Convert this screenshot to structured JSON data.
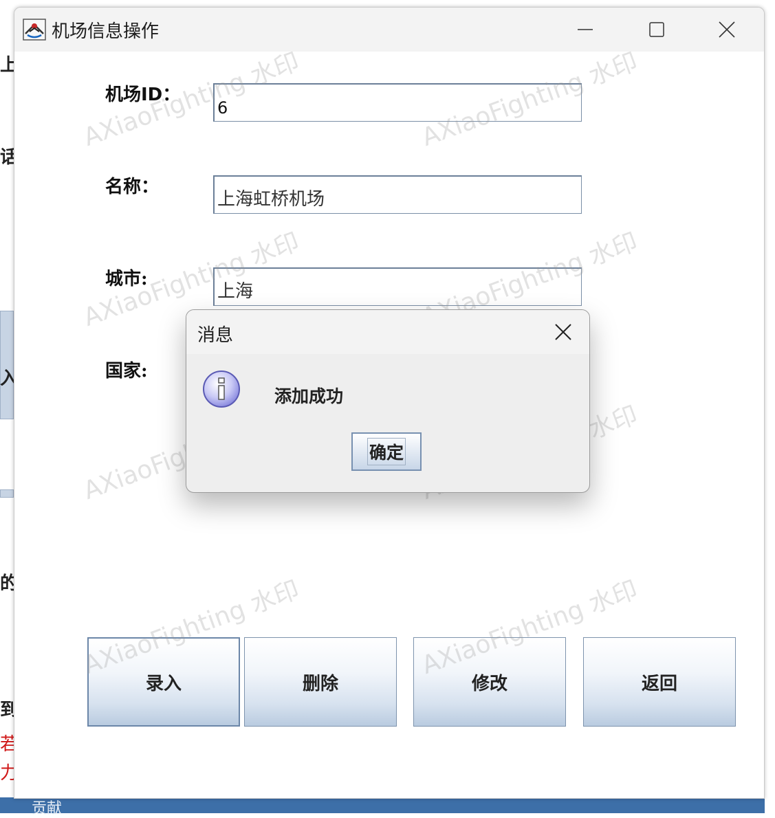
{
  "window": {
    "title": "机场信息操作",
    "controls": {
      "minimize": "minimize",
      "maximize": "maximize",
      "close": "close"
    }
  },
  "form": {
    "airport_id_label": "机场ID：",
    "airport_id_value": "6",
    "name_label": "名称：",
    "name_value": "上海虹桥机场",
    "city_label": "城市:",
    "city_value": "上海",
    "country_label": "国家:"
  },
  "actions": {
    "enter": "录入",
    "delete": "删除",
    "modify": "修改",
    "back": "返回"
  },
  "dialog": {
    "title": "消息",
    "message": "添加成功",
    "ok": "确定",
    "icon": "info-icon"
  },
  "watermark": "AXiaoFighting 水印",
  "background": {
    "fragments": [
      "上",
      "话",
      "入",
      "的",
      "到",
      "若",
      "力"
    ],
    "taskbar_text": "贡献"
  },
  "colors": {
    "button_gradient_bottom": "#b9cbe0",
    "field_border": "#7a8ea6",
    "info_icon": "#b9b9f2"
  }
}
